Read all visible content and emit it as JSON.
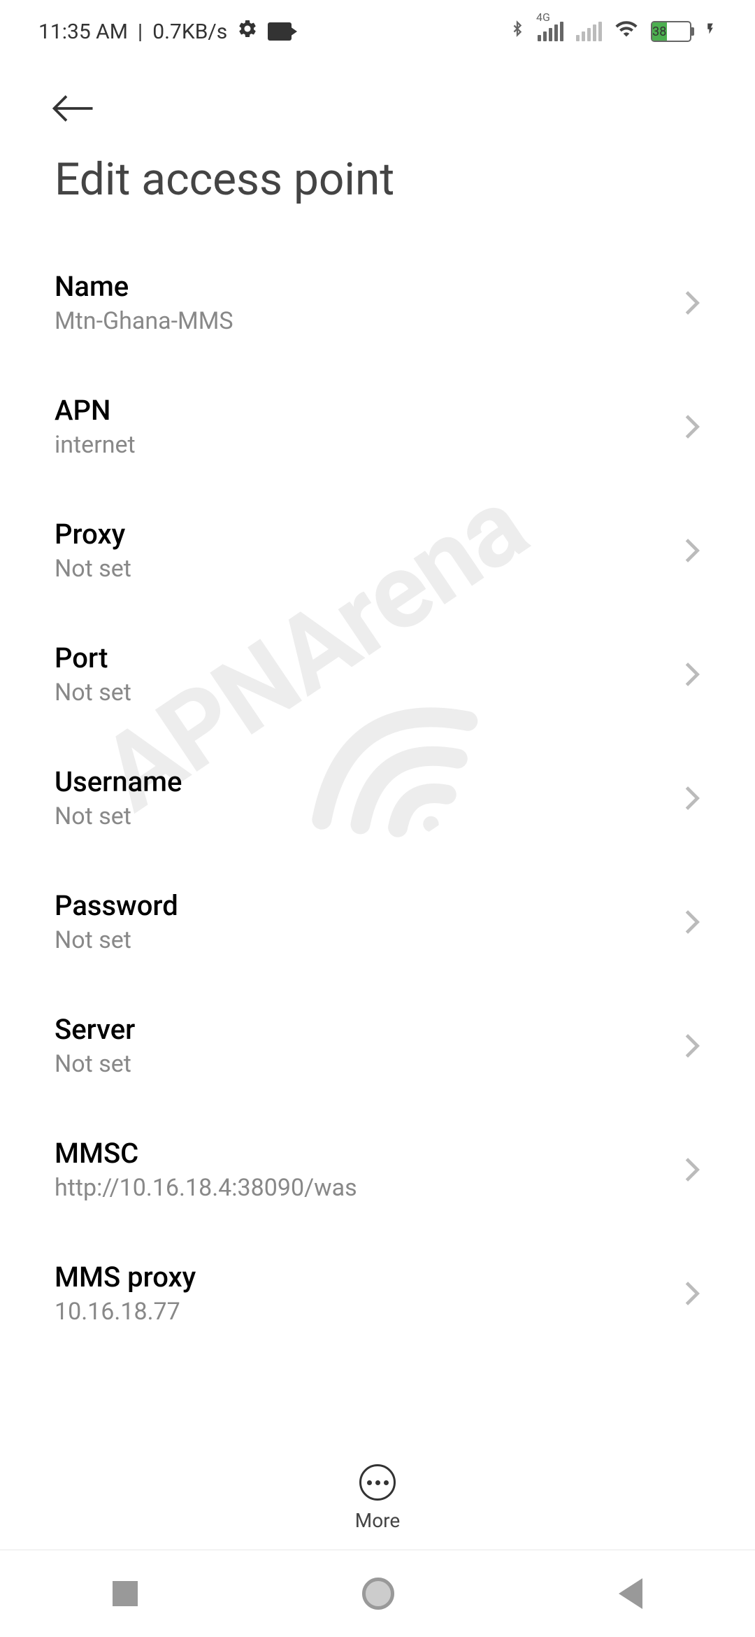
{
  "statusBar": {
    "time": "11:35 AM",
    "separator": "|",
    "dataRate": "0.7KB/s",
    "networkLabel": "4G",
    "batteryPercent": "38"
  },
  "page": {
    "title": "Edit access point"
  },
  "settings": [
    {
      "label": "Name",
      "value": "Mtn-Ghana-MMS"
    },
    {
      "label": "APN",
      "value": "internet"
    },
    {
      "label": "Proxy",
      "value": "Not set"
    },
    {
      "label": "Port",
      "value": "Not set"
    },
    {
      "label": "Username",
      "value": "Not set"
    },
    {
      "label": "Password",
      "value": "Not set"
    },
    {
      "label": "Server",
      "value": "Not set"
    },
    {
      "label": "MMSC",
      "value": "http://10.16.18.4:38090/was"
    },
    {
      "label": "MMS proxy",
      "value": "10.16.18.77"
    }
  ],
  "bottomAction": {
    "label": "More"
  },
  "watermark": {
    "text": "APNArena"
  }
}
